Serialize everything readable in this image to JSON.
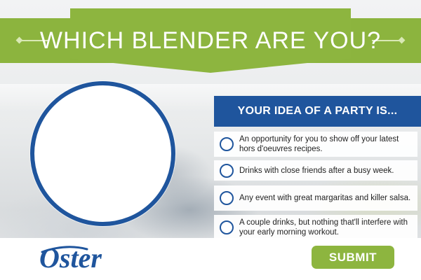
{
  "banner": {
    "title": "WHICH BLENDER ARE YOU?"
  },
  "question": {
    "heading": "YOUR IDEA OF A PARTY IS...",
    "options": [
      {
        "label": "An opportunity for you to show off your latest hors d'oeuvres recipes."
      },
      {
        "label": "Drinks with close friends after a busy week."
      },
      {
        "label": "Any event with great margaritas and killer salsa."
      },
      {
        "label": "A couple drinks, but nothing that'll interfere with your early morning workout."
      }
    ]
  },
  "brand": {
    "logo_text": "Oster"
  },
  "footer": {
    "submit_label": "SUBMIT"
  },
  "colors": {
    "brand_green": "#8db53f",
    "brand_blue": "#1f559d"
  }
}
